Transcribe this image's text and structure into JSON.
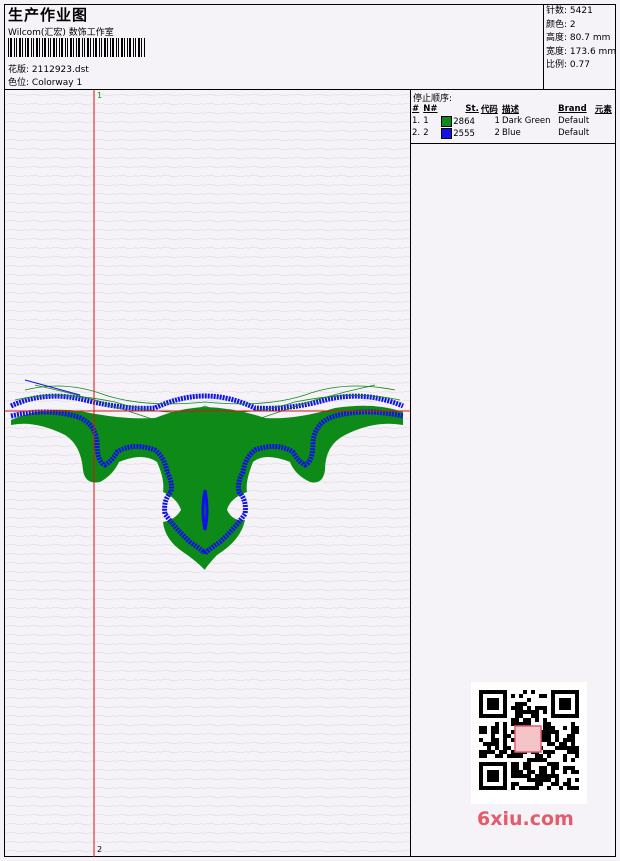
{
  "header": {
    "title": "生产作业图",
    "company": "Wilcom(汇宏) 数饰工作室",
    "design_label": "花版:",
    "design_value": "2112923.dst",
    "colorway_label": "色位:",
    "colorway_value": "Colorway 1"
  },
  "stats": [
    {
      "label": "针数:",
      "value": "5421"
    },
    {
      "label": "颜色:",
      "value": "2"
    },
    {
      "label": "高度:",
      "value": "80.7 mm"
    },
    {
      "label": "宽度:",
      "value": "173.6 mm"
    },
    {
      "label": "比例:",
      "value": "0.77"
    }
  ],
  "stop_sequence": {
    "heading": "停止顺序:",
    "columns": [
      "#",
      "N#",
      "St.",
      "代码",
      "描述",
      "Brand",
      "元素"
    ],
    "rows": [
      {
        "index": "1.",
        "n": "1",
        "stitches": "2864",
        "code": "1",
        "description": "Dark Green",
        "brand": "Default",
        "color": "#0e8a18"
      },
      {
        "index": "2.",
        "n": "2",
        "stitches": "2555",
        "code": "2",
        "description": "Blue",
        "brand": "Default",
        "color": "#1010e8"
      }
    ]
  },
  "canvas": {
    "marker_top": "1",
    "marker_bottom": "2",
    "thread_colors": {
      "green": "#0e8a18",
      "blue": "#1010e8",
      "guide": "#e01010"
    }
  },
  "watermark": "6xiu.com"
}
